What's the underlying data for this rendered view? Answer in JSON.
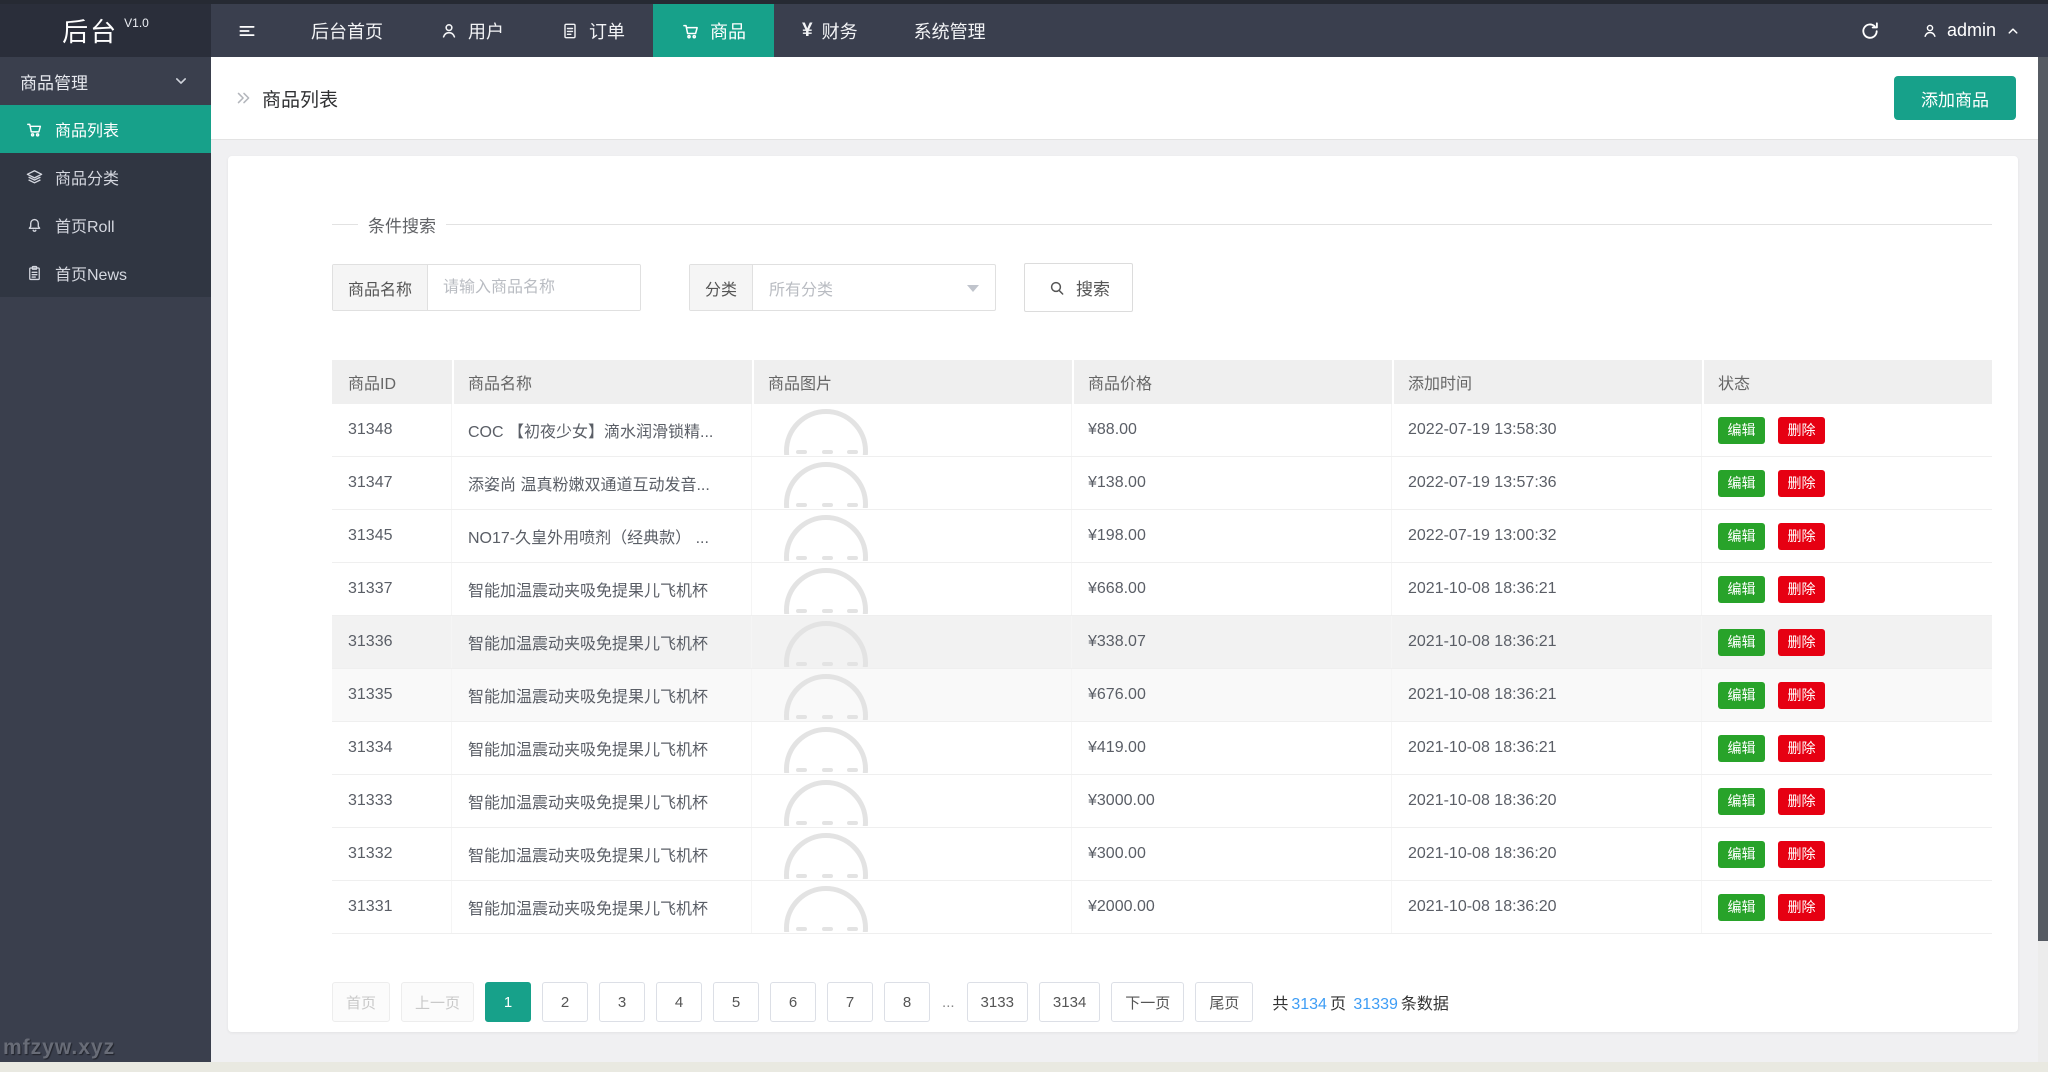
{
  "app": {
    "title": "后台",
    "version": "V1.0"
  },
  "topnav": {
    "items": [
      {
        "name": "home",
        "label": "后台首页",
        "icon": null,
        "active": false
      },
      {
        "name": "users",
        "label": "用户",
        "icon": "user-icon",
        "active": false
      },
      {
        "name": "orders",
        "label": "订单",
        "icon": "order-icon",
        "active": false
      },
      {
        "name": "products",
        "label": "商品",
        "icon": "cart-icon",
        "active": true
      },
      {
        "name": "finance",
        "label": "财务",
        "icon": "yen-icon",
        "active": false
      },
      {
        "name": "system",
        "label": "系统管理",
        "icon": null,
        "active": false
      }
    ],
    "username": "admin"
  },
  "sidebar": {
    "group_label": "商品管理",
    "items": [
      {
        "name": "product-list",
        "label": "商品列表",
        "icon": "cart-icon",
        "active": true
      },
      {
        "name": "product-category",
        "label": "商品分类",
        "icon": "layers-icon",
        "active": false
      },
      {
        "name": "home-roll",
        "label": "首页Roll",
        "icon": "bell-icon",
        "active": false
      },
      {
        "name": "home-news",
        "label": "首页News",
        "icon": "clipboard-icon",
        "active": false
      }
    ],
    "watermark": "mfzyw.xyz"
  },
  "breadcrumb": {
    "title": "商品列表",
    "add_button_label": "添加商品"
  },
  "search": {
    "legend": "条件搜索",
    "name_label": "商品名称",
    "name_placeholder": "请输入商品名称",
    "name_value": "",
    "category_label": "分类",
    "category_value": "所有分类",
    "button_label": "搜索"
  },
  "table": {
    "headers": [
      "商品ID",
      "商品名称",
      "商品图片",
      "商品价格",
      "添加时间",
      "状态"
    ],
    "edit_label": "编辑",
    "delete_label": "删除",
    "rows": [
      {
        "id": "31348",
        "name": "COC 【初夜少女】滴水润滑锁精...",
        "price": "¥88.00",
        "time": "2022-07-19 13:58:30",
        "highlight": ""
      },
      {
        "id": "31347",
        "name": "添姿尚 温真粉嫩双通道互动发音...",
        "price": "¥138.00",
        "time": "2022-07-19 13:57:36",
        "highlight": ""
      },
      {
        "id": "31345",
        "name": "NO17-久皇外用喷剂（经典款） ...",
        "price": "¥198.00",
        "time": "2022-07-19 13:00:32",
        "highlight": ""
      },
      {
        "id": "31337",
        "name": "智能加温震动夹吸免提果儿飞机杯",
        "price": "¥668.00",
        "time": "2021-10-08 18:36:21",
        "highlight": ""
      },
      {
        "id": "31336",
        "name": "智能加温震动夹吸免提果儿飞机杯",
        "price": "¥338.07",
        "time": "2021-10-08 18:36:21",
        "highlight": "strong"
      },
      {
        "id": "31335",
        "name": "智能加温震动夹吸免提果儿飞机杯",
        "price": "¥676.00",
        "time": "2021-10-08 18:36:21",
        "highlight": "soft"
      },
      {
        "id": "31334",
        "name": "智能加温震动夹吸免提果儿飞机杯",
        "price": "¥419.00",
        "time": "2021-10-08 18:36:21",
        "highlight": ""
      },
      {
        "id": "31333",
        "name": "智能加温震动夹吸免提果儿飞机杯",
        "price": "¥3000.00",
        "time": "2021-10-08 18:36:20",
        "highlight": ""
      },
      {
        "id": "31332",
        "name": "智能加温震动夹吸免提果儿飞机杯",
        "price": "¥300.00",
        "time": "2021-10-08 18:36:20",
        "highlight": ""
      },
      {
        "id": "31331",
        "name": "智能加温震动夹吸免提果儿飞机杯",
        "price": "¥2000.00",
        "time": "2021-10-08 18:36:20",
        "highlight": ""
      }
    ]
  },
  "pagination": {
    "first_label": "首页",
    "prev_label": "上一页",
    "pages": [
      "1",
      "2",
      "3",
      "4",
      "5",
      "6",
      "7",
      "8",
      "...",
      "3133",
      "3134"
    ],
    "active_page": "1",
    "next_label": "下一页",
    "last_label": "尾页",
    "summary": {
      "prefix": "共",
      "total_pages": "3134",
      "pages_unit": "页",
      "total_records": "31339",
      "records_unit": "条数据"
    }
  },
  "colors": {
    "accent_teal": "#17a18a",
    "edit_green": "#28a32a",
    "delete_red": "#e60012",
    "link_blue": "#3e9df5"
  }
}
